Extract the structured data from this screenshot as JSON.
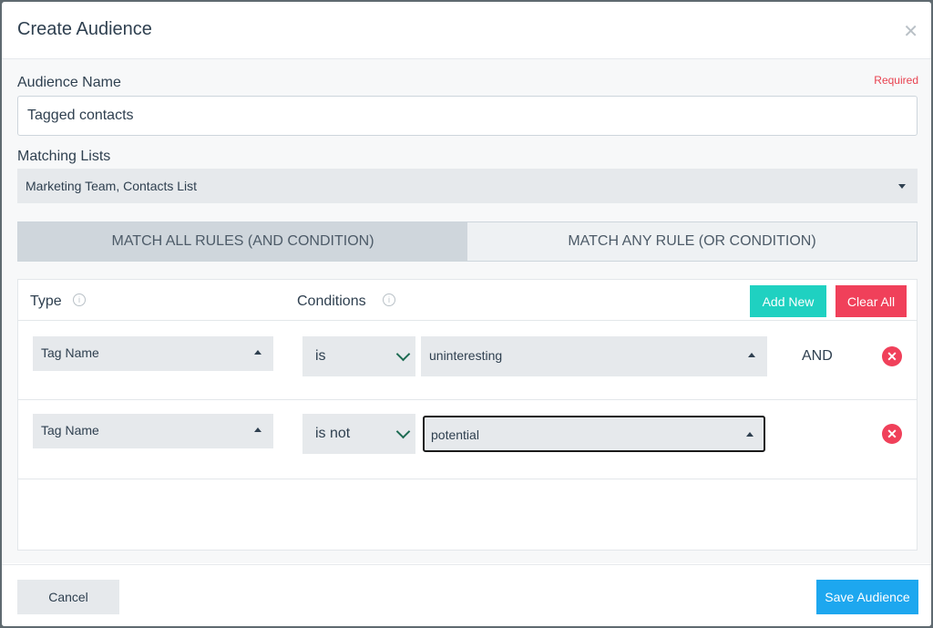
{
  "modal": {
    "title": "Create Audience",
    "close_icon": "close-icon"
  },
  "audience_name": {
    "label": "Audience Name",
    "required_text": "Required",
    "value": "Tagged contacts"
  },
  "matching_lists": {
    "label": "Matching Lists",
    "value": "Marketing Team, Contacts List"
  },
  "match_mode": {
    "all_label": "MATCH ALL RULES (AND CONDITION)",
    "any_label": "MATCH ANY RULE (OR CONDITION)",
    "selected": "all"
  },
  "rules": {
    "type_header": "Type",
    "conditions_header": "Conditions",
    "add_new_label": "Add New",
    "clear_all_label": "Clear All",
    "rows": [
      {
        "type": "Tag Name",
        "operator": "is",
        "value": "uninteresting",
        "joiner": "AND"
      },
      {
        "type": "Tag Name",
        "operator": "is not",
        "value": "potential",
        "joiner": ""
      }
    ]
  },
  "footer": {
    "cancel_label": "Cancel",
    "save_label": "Save Audience"
  },
  "colors": {
    "add_new": "#1fd1c1",
    "clear_all": "#f0405a",
    "save": "#1da7ef",
    "required": "#e8414f"
  }
}
